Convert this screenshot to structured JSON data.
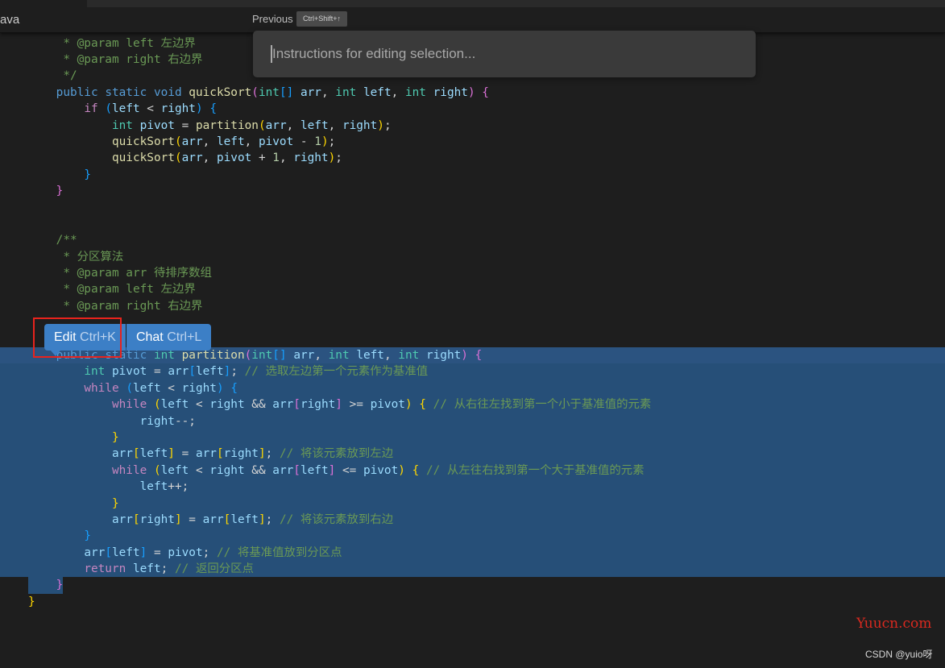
{
  "tab": {
    "filename_fragment": "ava"
  },
  "history": {
    "previous_label": "Previous",
    "previous_shortcut": "Ctrl+Shift+↑"
  },
  "prompt": {
    "placeholder": "Instructions for editing selection...",
    "value": ""
  },
  "popup": {
    "edit_label": "Edit",
    "edit_shortcut": "Ctrl+K",
    "chat_label": "Chat",
    "chat_shortcut": "Ctrl+L",
    "accent_color": "#3c7fc6",
    "highlight_box_color": "#e8231d"
  },
  "editor": {
    "selection_color": "#264f78",
    "selection_start_line": 20,
    "selection_end_line": 34,
    "lines": [
      "     * @param arr 待排序数组",
      "     * @param left 左边界",
      "     * @param right 右边界",
      "     */",
      "    public static void quickSort(int[] arr, int left, int right) {",
      "        if (left < right) {",
      "            int pivot = partition(arr, left, right);",
      "            quickSort(arr, left, pivot - 1);",
      "            quickSort(arr, pivot + 1, right);",
      "        }",
      "    }",
      "",
      "",
      "    /**",
      "     * 分区算法",
      "     * @param arr 待排序数组",
      "     * @param left 左边界",
      "     * @param right 右边界",
      "",
      "     */",
      "    public static int partition(int[] arr, int left, int right) {",
      "        int pivot = arr[left]; // 选取左边第一个元素作为基准值",
      "        while (left < right) {",
      "            while (left < right && arr[right] >= pivot) { // 从右往左找到第一个小于基准值的元素",
      "                right--;",
      "            }",
      "            arr[left] = arr[right]; // 将该元素放到左边",
      "            while (left < right && arr[left] <= pivot) { // 从左往右找到第一个大于基准值的元素",
      "                left++;",
      "            }",
      "            arr[right] = arr[left]; // 将该元素放到右边",
      "        }",
      "        arr[left] = pivot; // 将基准值放到分区点",
      "        return left; // 返回分区点",
      "    }",
      "}"
    ]
  },
  "watermarks": {
    "site": "Yuucn.com",
    "author": "CSDN @yuio呀"
  }
}
